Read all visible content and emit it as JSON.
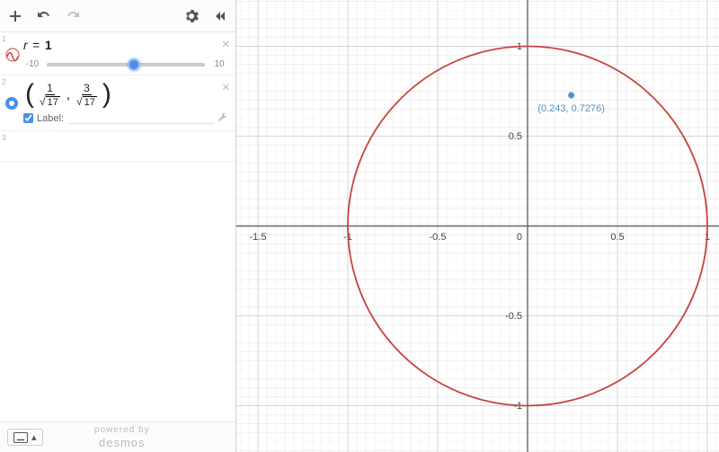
{
  "toolbar": {
    "add_label": "+",
    "undo_label": "↶",
    "redo_label": "↷",
    "settings_label": "⚙",
    "collapse_label": "«"
  },
  "expr1": {
    "index": "1",
    "formula_lhs": "r",
    "formula_eq": "=",
    "formula_rhs": "1",
    "slider_min": "-10",
    "slider_max": "10",
    "slider_value": 1
  },
  "expr2": {
    "index": "2",
    "num1": "1",
    "den1": "17",
    "num2": "3",
    "den2": "17",
    "comma": ",",
    "label_checkbox_text": "Label:"
  },
  "expr3": {
    "index": "3"
  },
  "footer": {
    "keyboard": "⌨",
    "caret": "▴",
    "powered": "powered by",
    "brand": "desmos"
  },
  "graph": {
    "ticks_x": [
      "-1.5",
      "-1",
      "-0.5",
      "0",
      "0.5",
      "1"
    ],
    "ticks_y_pos": [
      "0.5",
      "1"
    ],
    "ticks_y_neg": [
      "-0.5",
      "-1"
    ],
    "point_label": "(0.243, 0.7276)"
  },
  "chart_data": {
    "type": "scatter",
    "title": "",
    "xlabel": "",
    "ylabel": "",
    "xlim": [
      -1.6,
      1.1
    ],
    "ylim": [
      -1.25,
      1.25
    ],
    "series": [
      {
        "name": "circle r=1",
        "kind": "polar-curve",
        "equation": "r=1"
      },
      {
        "name": "point",
        "kind": "point",
        "x": 0.243,
        "y": 0.7276,
        "label": "(0.243, 0.7276)"
      }
    ]
  }
}
